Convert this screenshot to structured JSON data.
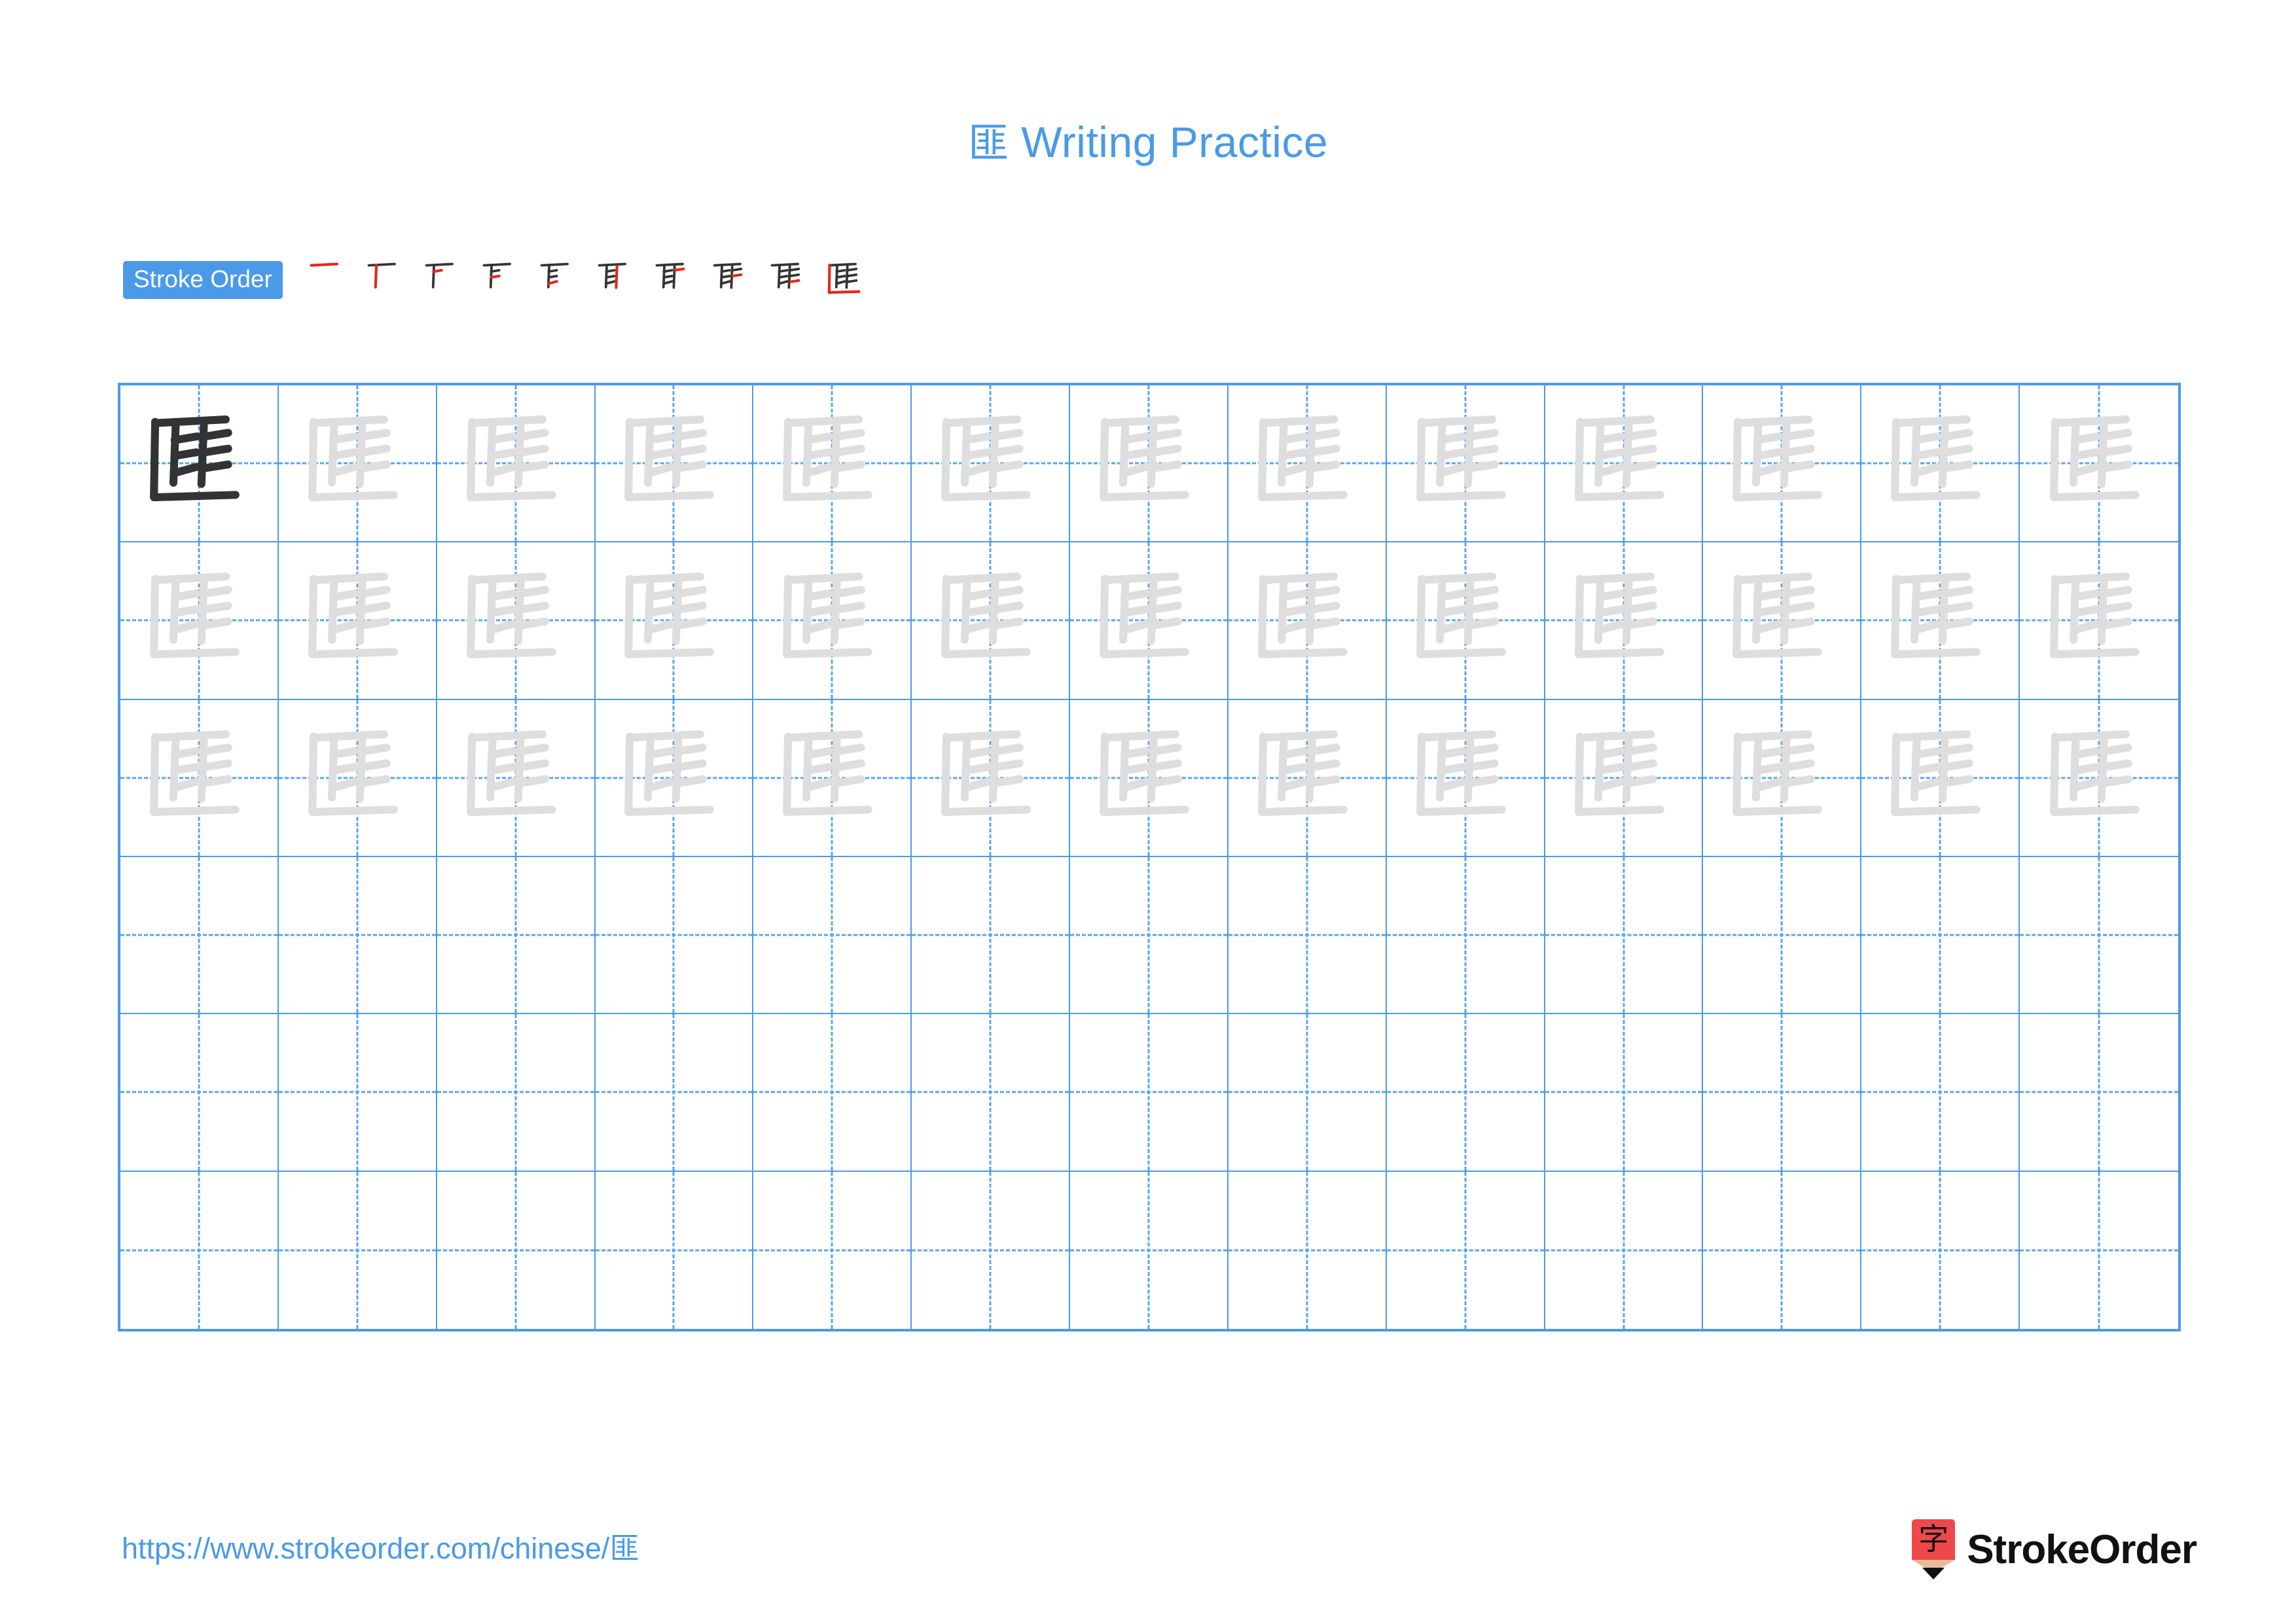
{
  "character": "匪",
  "colors": {
    "accent_blue": "#4a9ae8",
    "grid_line": "#4a9ae8",
    "grid_dash": "#5aa5ec",
    "active_stroke_red": "#e8241a",
    "done_stroke_dark": "#333333",
    "trace_gray": "#dedede",
    "logo_red": "#f0474b"
  },
  "header": {
    "title_char": "匪",
    "title_text": " Writing Practice"
  },
  "stroke_order": {
    "badge_label": "Stroke Order",
    "total_strokes": 10,
    "steps": [
      {
        "index": 1,
        "stroke_count": 1
      },
      {
        "index": 2,
        "stroke_count": 2
      },
      {
        "index": 3,
        "stroke_count": 3
      },
      {
        "index": 4,
        "stroke_count": 4
      },
      {
        "index": 5,
        "stroke_count": 5
      },
      {
        "index": 6,
        "stroke_count": 6
      },
      {
        "index": 7,
        "stroke_count": 7
      },
      {
        "index": 8,
        "stroke_count": 8
      },
      {
        "index": 9,
        "stroke_count": 9
      },
      {
        "index": 10,
        "stroke_count": 10
      }
    ]
  },
  "grid": {
    "columns": 13,
    "rows": 6,
    "filled_rows": 3,
    "empty_rows": 3,
    "model_cell": {
      "row": 1,
      "column": 1,
      "style": "dark"
    },
    "trace_style": "gray"
  },
  "footer": {
    "url_text": "https://www.strokeorder.com/chinese/",
    "url_char": "匪",
    "brand_name": "StrokeOrder",
    "brand_mark_char": "字"
  }
}
